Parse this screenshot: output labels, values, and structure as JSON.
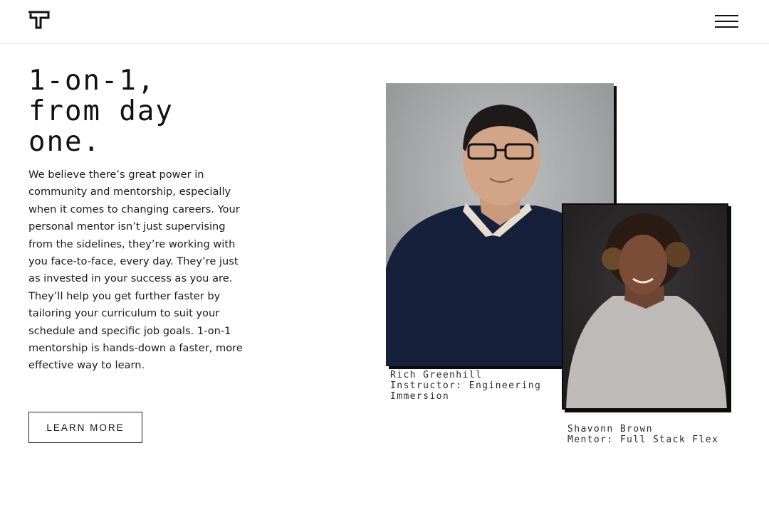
{
  "header": {
    "logo_icon": "t-logo-icon",
    "menu_icon": "hamburger-menu-icon"
  },
  "hero": {
    "headline": "1-on-1,\nfrom day\none.",
    "body": "We believe there’s great power in community and mentorship, especially when it comes to changing careers. Your personal mentor isn’t just supervising from the sidelines, they’re working with you face-to-face, every day. They’re just as invested in your success as you are. They’ll help you get further faster by tailoring your curriculum to suit your schedule and specific job goals. 1-on-1 mentorship is hands-down a faster, more effective way to learn.",
    "cta_label": "LEARN MORE"
  },
  "people": [
    {
      "name": "Rich Greenhill",
      "role_line1": "Instructor: Engineering",
      "role_line2": "Immersion"
    },
    {
      "name": "Shavonn Brown",
      "role_line1": "Mentor: Full Stack Flex"
    }
  ],
  "colors": {
    "text": "#111111",
    "header_border": "#e2e2e2",
    "photo_frame": "#0b0b0b"
  }
}
